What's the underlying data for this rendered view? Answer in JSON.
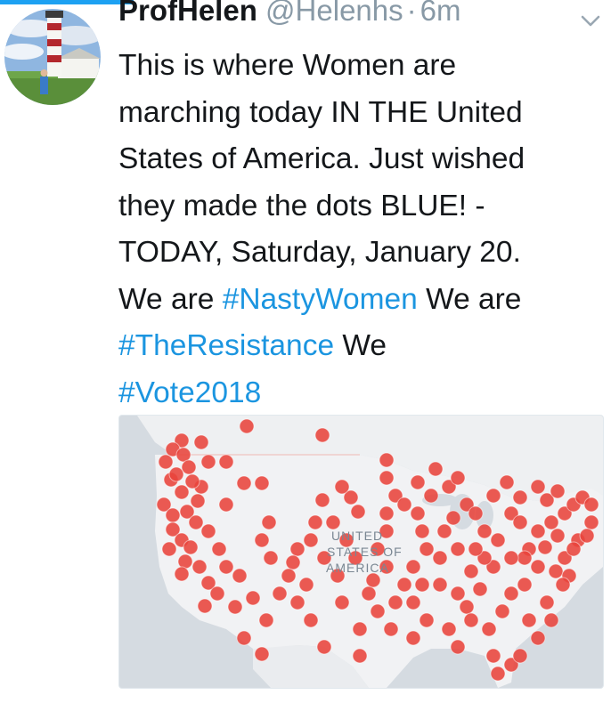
{
  "tweet": {
    "display_name": "ProfHelen",
    "handle": "@Helenhs",
    "separator": "·",
    "timestamp": "6m",
    "text_lines": [
      "This is where Women are",
      "marching today IN THE United",
      "States of America. Just wished",
      "they made the dots BLUE! -",
      "TODAY, Saturday, January 20."
    ],
    "text_we_are_1": "We are ",
    "hashtag_1": "#NastyWomen",
    "text_we_are_2": " We are",
    "hashtag_2": "#TheResistance",
    "text_we": " We",
    "hashtag_3": "#Vote2018"
  },
  "media": {
    "map_labels": [
      "UNITED",
      "STATES OF",
      "AMERICA"
    ],
    "dot_color": "#e8433b",
    "land_color": "#eef0f2",
    "water_color": "#d5dbe1"
  },
  "icons": {
    "caret": "chevron-down-icon",
    "avatar": "lighthouse-avatar"
  },
  "colors": {
    "accent": "#1da1f2",
    "hashtag": "#1b95e0",
    "muted": "#8899a6"
  }
}
